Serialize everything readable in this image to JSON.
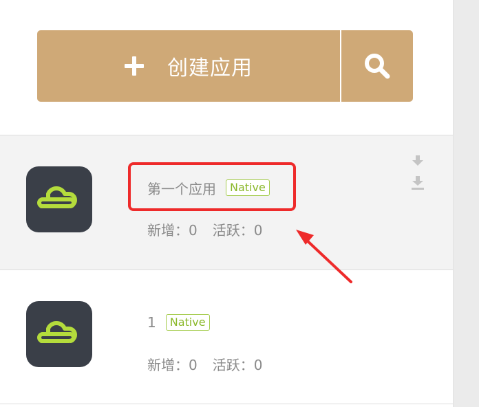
{
  "toolbar": {
    "create_label": "创建应用",
    "create_icon": "plus-icon",
    "search_icon": "search-icon",
    "button_color": "#cfa977"
  },
  "apps": [
    {
      "name": "第一个应用",
      "badge": "Native",
      "new_label": "新增：",
      "new_value": "0",
      "active_label": "活跃：",
      "active_value": "0",
      "icons": [
        "download-icon",
        "download-tray-icon"
      ],
      "highlighted": true
    },
    {
      "name": "1",
      "badge": "Native",
      "new_label": "新增：",
      "new_value": "0",
      "active_label": "活跃：",
      "active_value": "0",
      "highlighted": false
    }
  ],
  "colors": {
    "badge_green": "#8ab82a",
    "logo_bg": "#3a3f48",
    "logo_fg": "#b4dc3c",
    "annotation_red": "#ee2a2a"
  }
}
